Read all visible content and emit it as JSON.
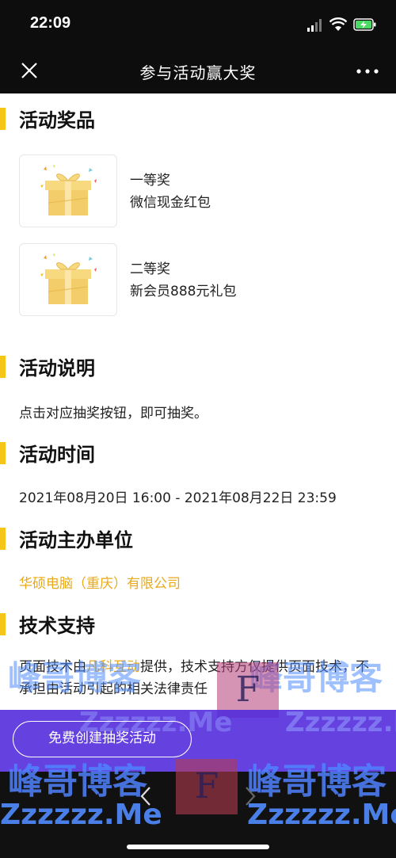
{
  "status_bar": {
    "time": "22:09"
  },
  "nav": {
    "title": "参与活动赢大奖"
  },
  "prizes_section": {
    "title": "活动奖品",
    "items": [
      {
        "rank": "一等奖",
        "name": "微信现金红包",
        "icon": "gift-box-icon"
      },
      {
        "rank": "二等奖",
        "name": "新会员888元礼包",
        "icon": "gift-box-icon"
      }
    ]
  },
  "description_section": {
    "title": "活动说明",
    "text": "点击对应抽奖按钮，即可抽奖。"
  },
  "time_section": {
    "title": "活动时间",
    "text": "2021年08月20日 16:00 - 2021年08月22日 23:59"
  },
  "organizer_section": {
    "title": "活动主办单位",
    "text": "华硕电脑（重庆）有限公司"
  },
  "tech_section": {
    "title": "技术支持",
    "text_before": "页面技术由",
    "link": "凡科互动",
    "text_after": "提供，技术支持方仅提供页面技术，不承担由活动引起的相关法律责任"
  },
  "cta": {
    "label": "免费创建抽奖活动"
  },
  "watermarks": {
    "cn": "峰哥博客",
    "en": "Zzzzzz.Me",
    "letter": "F"
  },
  "colors": {
    "accent": "#f5c518",
    "link": "#e8a91a",
    "band": "#5028dc"
  }
}
